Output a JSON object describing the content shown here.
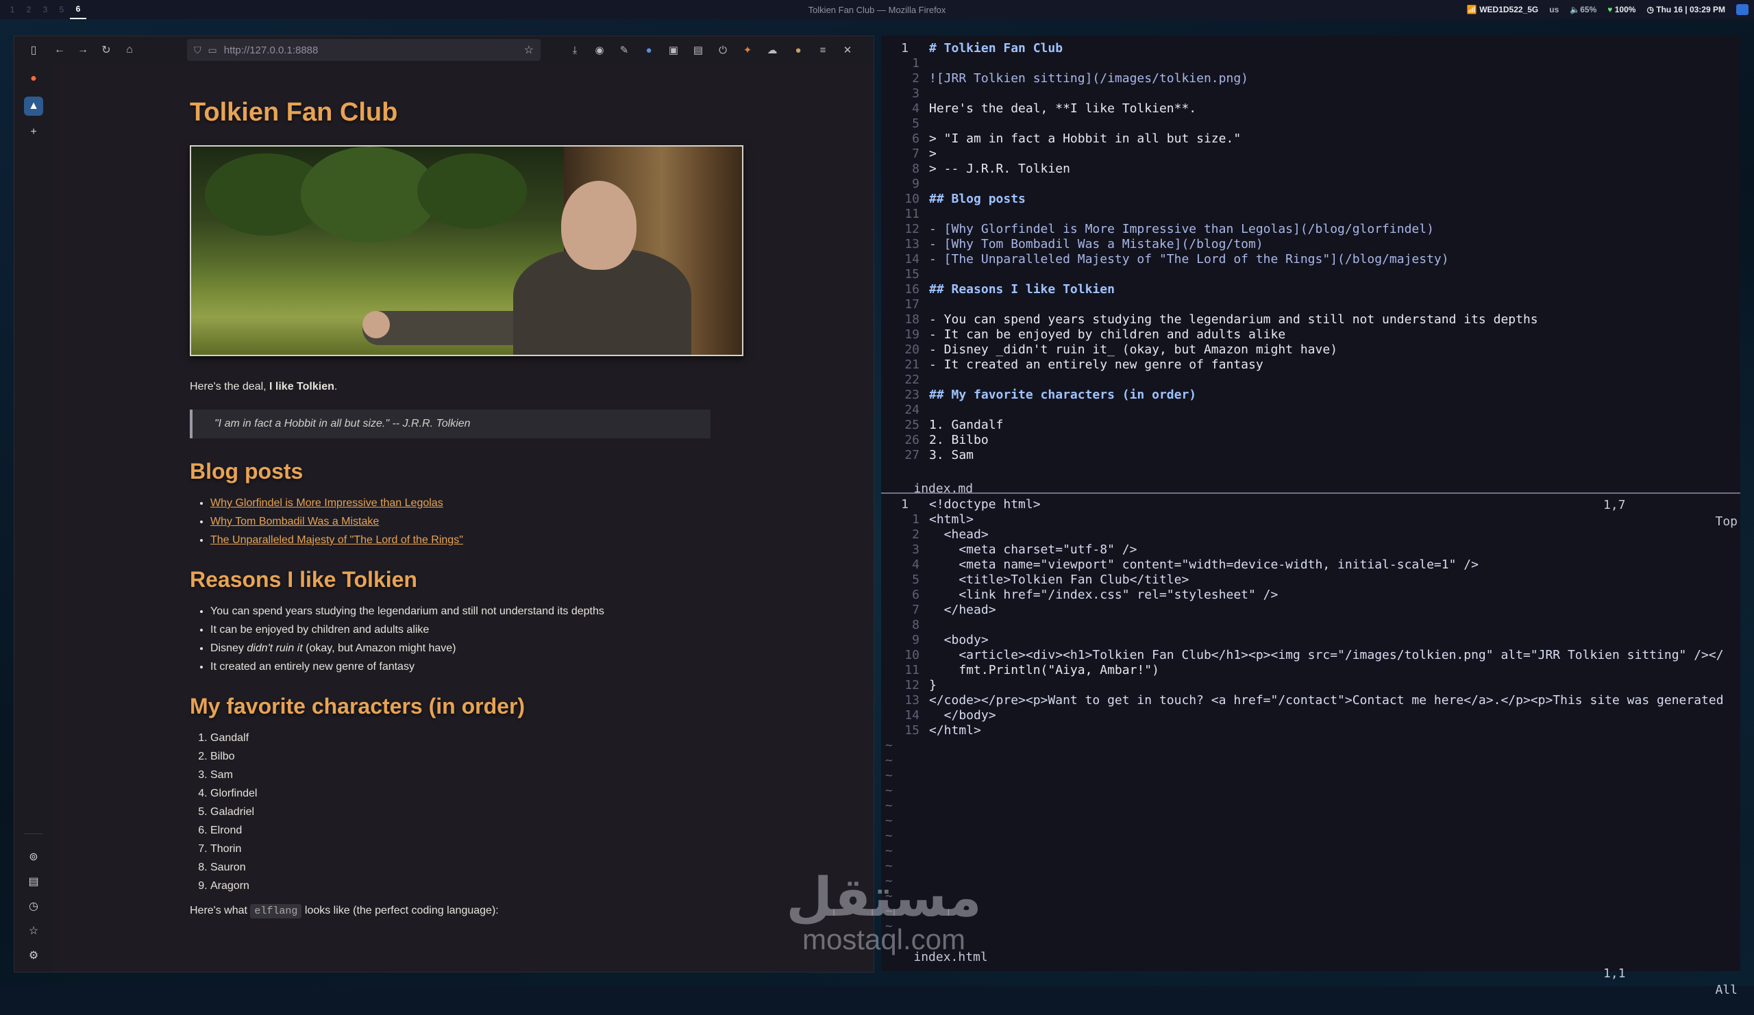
{
  "topbar": {
    "workspaces": [
      "1",
      "2",
      "3",
      "5",
      "6"
    ],
    "active_workspace": "6",
    "window_title": "Tolkien Fan Club — Mozilla Firefox",
    "wifi": "WED1D522_5G",
    "keyboard": "us",
    "volume": "65%",
    "battery": "100%",
    "datetime": "Thu 16 | 03:29 PM"
  },
  "browser": {
    "url": "http://127.0.0.1:8888"
  },
  "site": {
    "title": "Tolkien Fan Club",
    "intro_prefix": "Here's the deal, ",
    "intro_bold": "I like Tolkien",
    "intro_suffix": ".",
    "quote": "\"I am in fact a Hobbit in all but size.\" -- J.R.R. Tolkien",
    "blog_heading": "Blog posts",
    "blog_posts": [
      "Why Glorfindel is More Impressive than Legolas",
      "Why Tom Bombadil Was a Mistake",
      "The Unparalleled Majesty of \"The Lord of the Rings\""
    ],
    "reasons_heading": "Reasons I like Tolkien",
    "reasons": [
      "You can spend years studying the legendarium and still not understand its depths",
      "It can be enjoyed by children and adults alike",
      "Disney ",
      "It created an entirely new genre of fantasy"
    ],
    "reason3_italic": "didn't ruin it",
    "reason3_suffix": " (okay, but Amazon might have)",
    "chars_heading": "My favorite characters (in order)",
    "characters": [
      "Gandalf",
      "Bilbo",
      "Sam",
      "Glorfindel",
      "Galadriel",
      "Elrond",
      "Thorin",
      "Sauron",
      "Aragorn"
    ],
    "code_prefix": "Here's what ",
    "code_word": "elflang",
    "code_suffix": " looks like (the perfect coding language):"
  },
  "editor_top": {
    "filename": "index.md",
    "position": "1,7",
    "scroll": "Top",
    "line_numbers": [
      "1",
      "1",
      "2",
      "3",
      "4",
      "5",
      "6",
      "7",
      "8",
      "9",
      "10",
      "11",
      "12",
      "13",
      "14",
      "15",
      "16",
      "17",
      "18",
      "19",
      "20",
      "21",
      "22",
      "23",
      "24",
      "25",
      "26",
      "27"
    ],
    "lines": [
      "# Tolkien Fan Club",
      "",
      "![JRR Tolkien sitting](/images/tolkien.png)",
      "",
      "Here's the deal, **I like Tolkien**.",
      "",
      "> \"I am in fact a Hobbit in all but size.\"",
      ">",
      "> -- J.R.R. Tolkien",
      "",
      "## Blog posts",
      "",
      "- [Why Glorfindel is More Impressive than Legolas](/blog/glorfindel)",
      "- [Why Tom Bombadil Was a Mistake](/blog/tom)",
      "- [The Unparalleled Majesty of \"The Lord of the Rings\"](/blog/majesty)",
      "",
      "## Reasons I like Tolkien",
      "",
      "- You can spend years studying the legendarium and still not understand its depths",
      "- It can be enjoyed by children and adults alike",
      "- Disney _didn't ruin it_ (okay, but Amazon might have)",
      "- It created an entirely new genre of fantasy",
      "",
      "## My favorite characters (in order)",
      "",
      "1. Gandalf",
      "2. Bilbo",
      "3. Sam"
    ]
  },
  "editor_bottom": {
    "filename": "index.html",
    "position": "1,1",
    "scroll": "All",
    "line_numbers": [
      "1",
      "1",
      "2",
      "3",
      "4",
      "5",
      "6",
      "7",
      "8",
      "9",
      "10",
      "11",
      "12",
      "13",
      "14",
      "15"
    ],
    "lines": [
      "<!doctype html>",
      "<html>",
      "  <head>",
      "    <meta charset=\"utf-8\" />",
      "    <meta name=\"viewport\" content=\"width=device-width, initial-scale=1\" />",
      "    <title>Tolkien Fan Club</title>",
      "    <link href=\"/index.css\" rel=\"stylesheet\" />",
      "  </head>",
      "",
      "  <body>",
      "    <article><div><h1>Tolkien Fan Club</h1><p><img src=\"/images/tolkien.png\" alt=\"JRR Tolkien sitting\" /></",
      "    fmt.Println(\"Aiya, Ambar!\")",
      "}",
      "</code></pre><p>Want to get in touch? <a href=\"/contact\">Contact me here</a>.</p><p>This site was generated",
      "  </body>",
      "</html>"
    ]
  },
  "watermark": {
    "arabic": "مستقل",
    "latin": "mostaql.com"
  }
}
